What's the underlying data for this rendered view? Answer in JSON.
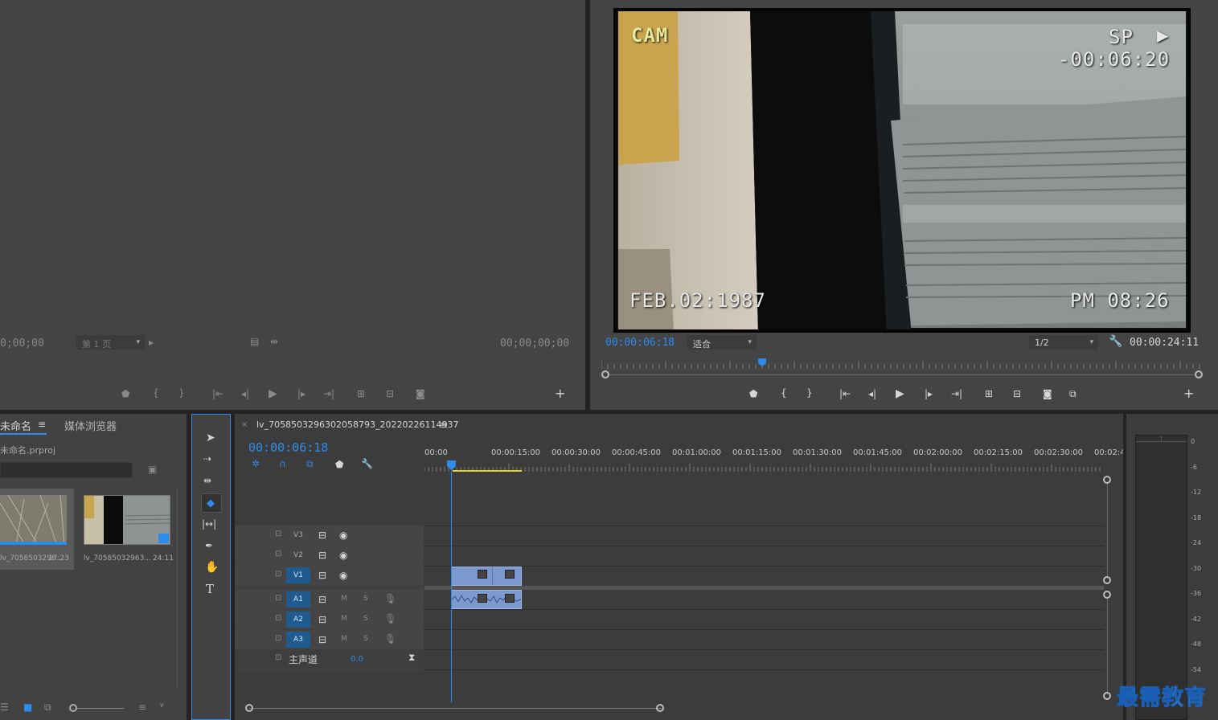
{
  "source_monitor": {
    "timecode_in": "0;00;00",
    "page_select": "第 1 页",
    "timecode_out": "00;00;00;00"
  },
  "program_monitor": {
    "osd": {
      "cam": "CAM",
      "sp": "SP",
      "counter": "-00:06:20",
      "date": "FEB.02:1987",
      "time": "PM 08:26"
    },
    "current_time": "00:00:06:18",
    "fit_label": "适合",
    "resolution": "1/2",
    "duration": "00:00:24:11",
    "playhead_fraction": 0.265
  },
  "project_panel": {
    "tab_project": "未命名",
    "tab_media": "媒体浏览器",
    "project_file": "未命名.prproj",
    "items": [
      {
        "name": "lv_7058503296...",
        "duration": "17:23"
      },
      {
        "name": "lv_70585032963...",
        "duration": "24:11"
      }
    ]
  },
  "timeline": {
    "sequence_name": "lv_7058503296302058793_20220226114937",
    "timecode": "00:00:06:18",
    "ruler": [
      "00:00",
      "00:00:15:00",
      "00:00:30:00",
      "00:00:45:00",
      "00:01:00:00",
      "00:01:15:00",
      "00:01:30:00",
      "00:01:45:00",
      "00:02:00:00",
      "00:02:15:00",
      "00:02:30:00",
      "00:02:45:"
    ],
    "video_tracks": [
      "V3",
      "V2",
      "V1"
    ],
    "audio_tracks": [
      "A1",
      "A2",
      "A3"
    ],
    "mute_label": "M",
    "solo_label": "S",
    "master_label": "主声道",
    "master_value": "0.0"
  },
  "meter": {
    "scale": [
      "0",
      "-6",
      "-12",
      "-18",
      "-24",
      "-30",
      "-36",
      "-42",
      "-48",
      "-54"
    ]
  },
  "watermark": "最需教育",
  "colors": {
    "accent": "#2d8ceb",
    "clip": "#7a9ad0",
    "target": "#1f5b8f",
    "work_area": "#e6d22a"
  }
}
